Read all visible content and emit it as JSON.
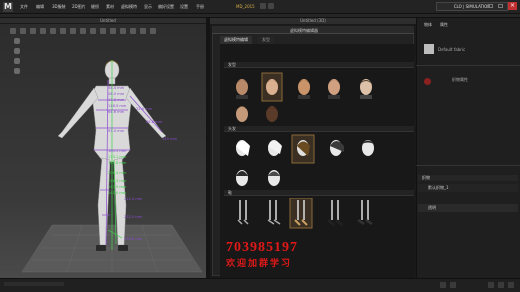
{
  "app": {
    "logo_letter": "M",
    "menu": [
      "文件",
      "编辑",
      "3D服装",
      "2D图片",
      "缝纫",
      "素材",
      "虚拟模特",
      "显示",
      "偏好设置",
      "设置",
      "手册"
    ],
    "document_title": "MD_2015",
    "brand": "CLO | SIMULATION"
  },
  "viewport": {
    "title": "Untitled",
    "measurements": [
      "54.4 mm",
      "28.0 mm",
      "17.8 mm",
      "116.5 mm",
      "22.0 mm",
      "64.6 mm",
      "86.8 mm",
      "145 mm",
      "93.0 mm",
      "160.5 mm",
      "173.1 mm",
      "185.8 mm",
      "206.4 mm",
      "212.4 mm",
      "232.5 mm",
      "236.6 mm",
      "158.3 mm",
      "147.9 mm",
      "141.0 mm"
    ]
  },
  "library": {
    "title": "Untitled (3D)",
    "window_title": "虚拟模特编辑器",
    "tabs": [
      "虚拟模特编辑",
      "发型"
    ],
    "sections": [
      "发型",
      "头发",
      "鞋"
    ]
  },
  "right_panel": {
    "tabs": [
      "物体",
      "属性"
    ],
    "item_label": "Default fabric",
    "section_title": "织物属性",
    "row_labels": [
      "织物",
      "默认织物_1",
      "透明"
    ]
  },
  "watermark": {
    "number": "703985197",
    "text": "欢迎加群学习"
  },
  "colors": {
    "accent_orange": "#d8b04a",
    "watermark_red": "#e01818",
    "measure_green": "#3fd24a",
    "measure_purple": "#8a4ccf"
  }
}
